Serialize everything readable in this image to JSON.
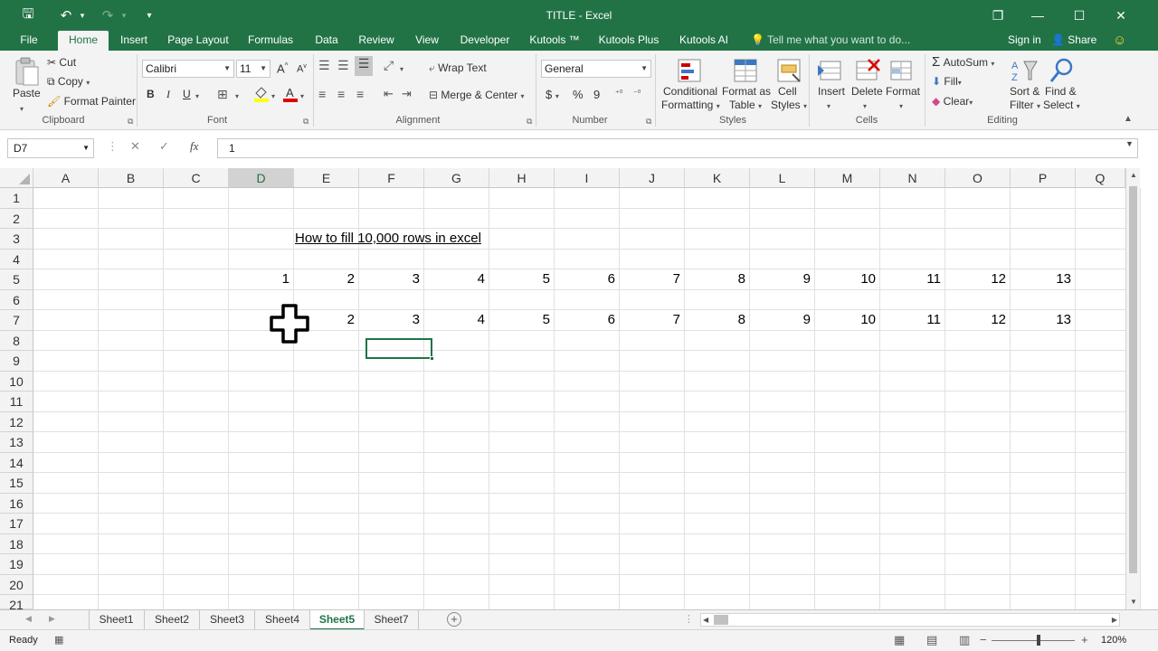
{
  "window": {
    "title": "TITLE - Excel",
    "minimize": "—",
    "maximize": "☐",
    "close": "✕",
    "restore": "❐"
  },
  "qat": {
    "save": "🖫",
    "undo": "↶",
    "redo": "↷",
    "customize": "▾"
  },
  "tabs": [
    "File",
    "Home",
    "Insert",
    "Page Layout",
    "Formulas",
    "Data",
    "Review",
    "View",
    "Developer",
    "Kutools ™",
    "Kutools Plus",
    "Kutools AI"
  ],
  "active_tab": "Home",
  "tell_me": "Tell me what you want to do...",
  "sign_in": "Sign in",
  "share": "Share",
  "ribbon": {
    "clipboard": {
      "paste": "Paste",
      "cut": "Cut",
      "copy": "Copy",
      "format_painter": "Format Painter",
      "label": "Clipboard"
    },
    "font": {
      "name": "Calibri",
      "size": "11",
      "bold": "B",
      "italic": "I",
      "underline": "U",
      "grow": "A",
      "shrink": "A",
      "label": "Font"
    },
    "alignment": {
      "wrap_text": "Wrap Text",
      "merge_center": "Merge & Center",
      "label": "Alignment"
    },
    "number": {
      "format": "General",
      "currency": "$",
      "percent": "%",
      "comma": "9",
      "label": "Number"
    },
    "styles": {
      "conditional": "Conditional",
      "formatting": "Formatting",
      "format_as": "Format as",
      "table": "Table",
      "cell": "Cell",
      "cell_styles": "Styles",
      "label": "Styles"
    },
    "cells": {
      "insert": "Insert",
      "delete": "Delete",
      "format": "Format",
      "label": "Cells"
    },
    "editing": {
      "autosum": "AutoSum",
      "fill": "Fill",
      "clear": "Clear",
      "sort": "Sort &",
      "filter": "Filter",
      "find": "Find &",
      "select": "Select",
      "label": "Editing"
    }
  },
  "formula_bar": {
    "name_box": "D7",
    "formula": "1",
    "fx": "fx",
    "cancel": "✕",
    "enter": "✓"
  },
  "columns": [
    "A",
    "B",
    "C",
    "D",
    "E",
    "F",
    "G",
    "H",
    "I",
    "J",
    "K",
    "L",
    "M",
    "N",
    "O",
    "P",
    "Q"
  ],
  "selected_column": "D",
  "rows": [
    "1",
    "2",
    "3",
    "4",
    "5",
    "6",
    "7",
    "8",
    "9",
    "10",
    "11",
    "12",
    "13",
    "14",
    "15",
    "16",
    "17",
    "18",
    "19",
    "20",
    "21"
  ],
  "title_cell": "How to fill 10,000 rows in excel",
  "row5_values": [
    "1",
    "2",
    "3",
    "4",
    "5",
    "6",
    "7",
    "8",
    "9",
    "10",
    "11",
    "12",
    "13"
  ],
  "row7_values": [
    "",
    "2",
    "3",
    "4",
    "5",
    "6",
    "7",
    "8",
    "9",
    "10",
    "11",
    "12",
    "13"
  ],
  "sheets": [
    "Sheet1",
    "Sheet2",
    "Sheet3",
    "Sheet4",
    "Sheet5",
    "Sheet7"
  ],
  "active_sheet": "Sheet5",
  "add_sheet": "+",
  "status": {
    "ready": "Ready",
    "zoom": "120%",
    "minus": "−",
    "plus": "+"
  }
}
